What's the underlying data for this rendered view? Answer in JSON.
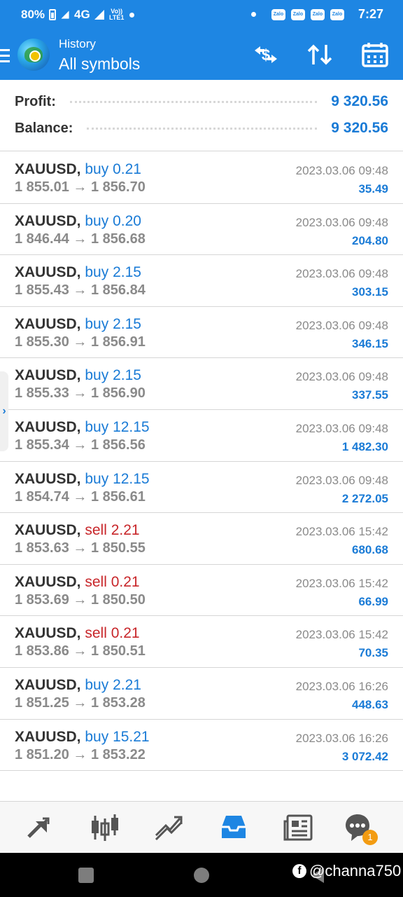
{
  "status_bar": {
    "battery": "80%",
    "network": "4G",
    "volte": "Vo)) LTE1",
    "zalo_label": "Zalo",
    "time": "7:27"
  },
  "app_bar": {
    "title": "History",
    "subtitle": "All symbols",
    "icons": [
      "menu-icon",
      "metatrader-logo",
      "currency-filter-icon",
      "sort-icon",
      "calendar-icon"
    ]
  },
  "summary": {
    "profit_label": "Profit:",
    "profit_value": "9 320.56",
    "balance_label": "Balance:",
    "balance_value": "9 320.56"
  },
  "trades": [
    {
      "symbol": "XAUUSD,",
      "side": "buy",
      "volume": "0.21",
      "open": "1 855.01",
      "close": "1 856.70",
      "time": "2023.03.06 09:48",
      "profit": "35.49"
    },
    {
      "symbol": "XAUUSD,",
      "side": "buy",
      "volume": "0.20",
      "open": "1 846.44",
      "close": "1 856.68",
      "time": "2023.03.06 09:48",
      "profit": "204.80"
    },
    {
      "symbol": "XAUUSD,",
      "side": "buy",
      "volume": "2.15",
      "open": "1 855.43",
      "close": "1 856.84",
      "time": "2023.03.06 09:48",
      "profit": "303.15"
    },
    {
      "symbol": "XAUUSD,",
      "side": "buy",
      "volume": "2.15",
      "open": "1 855.30",
      "close": "1 856.91",
      "time": "2023.03.06 09:48",
      "profit": "346.15"
    },
    {
      "symbol": "XAUUSD,",
      "side": "buy",
      "volume": "2.15",
      "open": "1 855.33",
      "close": "1 856.90",
      "time": "2023.03.06 09:48",
      "profit": "337.55"
    },
    {
      "symbol": "XAUUSD,",
      "side": "buy",
      "volume": "12.15",
      "open": "1 855.34",
      "close": "1 856.56",
      "time": "2023.03.06 09:48",
      "profit": "1 482.30"
    },
    {
      "symbol": "XAUUSD,",
      "side": "buy",
      "volume": "12.15",
      "open": "1 854.74",
      "close": "1 856.61",
      "time": "2023.03.06 09:48",
      "profit": "2 272.05"
    },
    {
      "symbol": "XAUUSD,",
      "side": "sell",
      "volume": "2.21",
      "open": "1 853.63",
      "close": "1 850.55",
      "time": "2023.03.06 15:42",
      "profit": "680.68"
    },
    {
      "symbol": "XAUUSD,",
      "side": "sell",
      "volume": "0.21",
      "open": "1 853.69",
      "close": "1 850.50",
      "time": "2023.03.06 15:42",
      "profit": "66.99"
    },
    {
      "symbol": "XAUUSD,",
      "side": "sell",
      "volume": "0.21",
      "open": "1 853.86",
      "close": "1 850.51",
      "time": "2023.03.06 15:42",
      "profit": "70.35"
    },
    {
      "symbol": "XAUUSD,",
      "side": "buy",
      "volume": "2.21",
      "open": "1 851.25",
      "close": "1 853.28",
      "time": "2023.03.06 16:26",
      "profit": "448.63"
    },
    {
      "symbol": "XAUUSD,",
      "side": "buy",
      "volume": "15.21",
      "open": "1 851.20",
      "close": "1 853.22",
      "time": "2023.03.06 16:26",
      "profit": "3 072.42"
    }
  ],
  "arrow_glyph": "→",
  "bottom_nav": {
    "items": [
      "quotes-icon",
      "chart-icon",
      "trade-icon",
      "history-icon",
      "news-icon",
      "messages-icon"
    ],
    "active": "history-icon",
    "messages_badge": "1"
  },
  "watermark": "@channa750",
  "colors": {
    "brand_blue": "#1e86e3",
    "buy_blue": "#1a7bd6",
    "sell_red": "#c8262a",
    "badge_orange": "#f39c12"
  }
}
